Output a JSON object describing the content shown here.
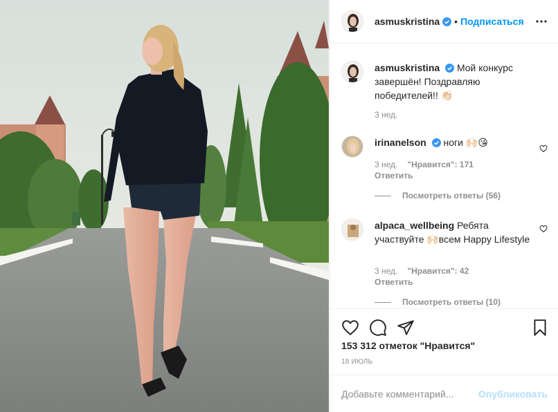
{
  "post": {
    "author": "asmuskristina",
    "follow_label": "Подписаться",
    "dot": "•"
  },
  "caption": {
    "username": "asmuskristina",
    "text": "Мой конкурс завершён! Поздравляю победителей!! 👏🏻",
    "time": "3 нед."
  },
  "comments": [
    {
      "username": "irinanelson",
      "text": "ноги 🙌🏻😘",
      "time": "3 нед.",
      "likes": "\"Нравится\": 171",
      "reply": "Ответить",
      "view_replies": "Посмотреть ответы (56)"
    },
    {
      "username": "alpaca_wellbeing",
      "text": "Ребята участвуйте 🙌🏻всем Happy Lifestyle",
      "time": "3 нед.",
      "likes": "\"Нравится\": 42",
      "reply": "Ответить",
      "view_replies": "Посмотреть ответы (10)"
    }
  ],
  "stats": {
    "likes": "153 312 отметок \"Нравится\"",
    "date": "18 ИЮЛЬ"
  },
  "add_comment": {
    "placeholder": "Добавьте комментарий...",
    "post_label": "Опубликовать"
  },
  "icons": {
    "verified": "verified-badge-icon",
    "more": "more-options-icon",
    "like": "heart-icon",
    "comment": "comment-icon",
    "share": "paper-plane-icon",
    "save": "bookmark-icon"
  },
  "colors": {
    "accent": "#0095f6",
    "post_disabled": "#b2dffc",
    "muted": "#8e8e8e",
    "text": "#262626"
  }
}
